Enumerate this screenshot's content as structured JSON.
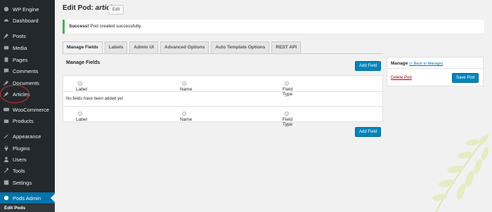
{
  "sidebar": {
    "items": [
      {
        "label": "WP Engine",
        "icon": "wp-engine-icon"
      },
      {
        "label": "Dashboard",
        "icon": "dashboard-icon"
      },
      {
        "label": "Posts",
        "icon": "pin-icon"
      },
      {
        "label": "Media",
        "icon": "media-icon"
      },
      {
        "label": "Pages",
        "icon": "pages-icon"
      },
      {
        "label": "Comments",
        "icon": "comments-icon"
      },
      {
        "label": "Documents",
        "icon": "pin-icon"
      },
      {
        "label": "Articles",
        "icon": "pin-icon"
      },
      {
        "label": "WooCommerce",
        "icon": "woocommerce-icon"
      },
      {
        "label": "Products",
        "icon": "products-icon"
      },
      {
        "label": "Appearance",
        "icon": "appearance-icon"
      },
      {
        "label": "Plugins",
        "icon": "plugins-icon"
      },
      {
        "label": "Users",
        "icon": "users-icon"
      },
      {
        "label": "Tools",
        "icon": "tools-icon"
      },
      {
        "label": "Settings",
        "icon": "settings-icon"
      },
      {
        "label": "Pods Admin",
        "icon": "pods-icon"
      }
    ],
    "sub_item": "Edit Pods"
  },
  "page": {
    "title_prefix": "Edit Pod:",
    "title_pod": "article",
    "edit_label": "Edit"
  },
  "notice": {
    "strong": "Success!",
    "text": " Pod created successfully."
  },
  "tabs": [
    "Manage Fields",
    "Labels",
    "Admin UI",
    "Advanced Options",
    "Auto Template Options",
    "REST API"
  ],
  "manage_fields": {
    "heading": "Manage Fields",
    "add_field": "Add Field",
    "columns": [
      "Label",
      "Name",
      "Field Type"
    ],
    "empty_message": "No fields have been added yet",
    "help_glyph": "?"
  },
  "manage": {
    "heading": "Manage",
    "back_link": "(« Back to Manage)",
    "delete": "Delete Pod",
    "save": "Save Pod"
  },
  "colors": {
    "sidebar_bg": "#23282d",
    "active_bg": "#0073aa",
    "primary_button": "#0085ba",
    "success_border": "#46b450",
    "delete_link": "#a00",
    "annotation_circle": "#d32f2f"
  }
}
